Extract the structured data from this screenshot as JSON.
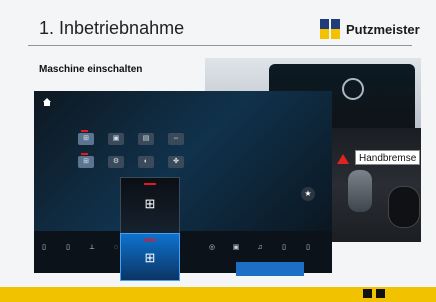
{
  "slide": {
    "title": "1. Inbetriebnahme",
    "subtitle": "Maschine einschalten",
    "brand": "Putzmeister"
  },
  "callout": {
    "label": "Handbremse"
  },
  "colors": {
    "accent": "#f0c200",
    "brand_blue": "#1f3d79",
    "warning_red": "#e02222"
  }
}
